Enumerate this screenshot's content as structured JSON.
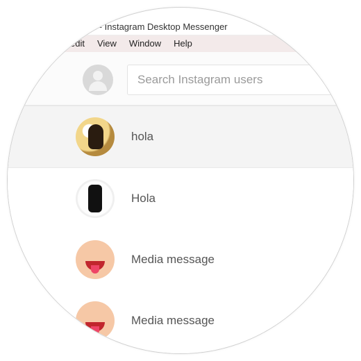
{
  "titlebar": {
    "text": "um - Instagram Desktop Messenger"
  },
  "menubar": {
    "items": [
      "edit",
      "View",
      "Window",
      "Help"
    ]
  },
  "search": {
    "placeholder": "Search Instagram users",
    "value": ""
  },
  "conversations": [
    {
      "label": "hola",
      "avatar_variant": "v1",
      "selected": true
    },
    {
      "label": "Hola",
      "avatar_variant": "v2",
      "selected": false
    },
    {
      "label": "Media message",
      "avatar_variant": "v3",
      "selected": false
    },
    {
      "label": "Media message",
      "avatar_variant": "v3",
      "selected": false
    }
  ]
}
